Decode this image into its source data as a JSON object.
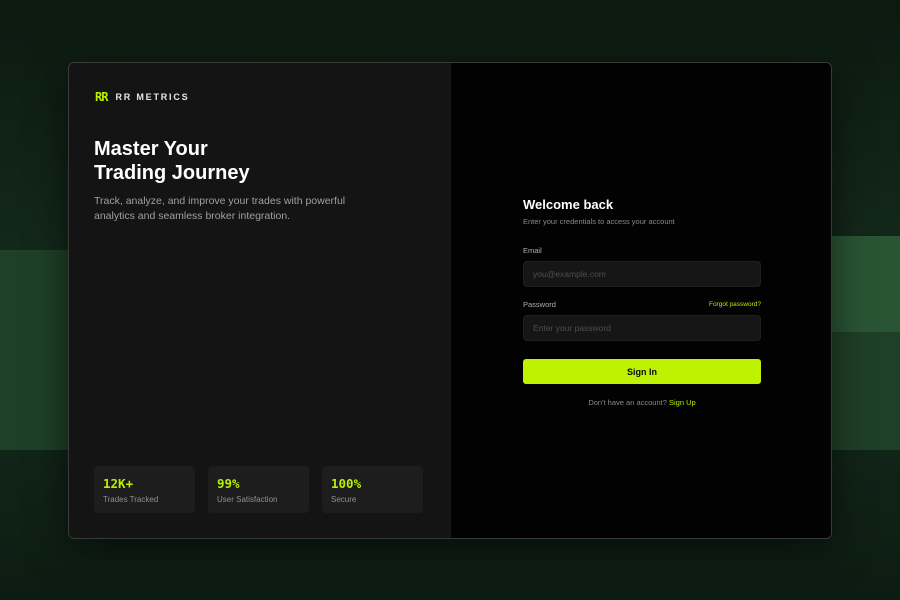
{
  "colors": {
    "accent": "#b8f000",
    "left_panel_bg": "#141414",
    "right_panel_bg": "#020202",
    "page_bg": "#0f1f14"
  },
  "brand": {
    "logo_text": "RR",
    "name": "RR METRICS"
  },
  "hero": {
    "title_line1": "Master Your",
    "title_line2": "Trading Journey",
    "subtitle": "Track, analyze, and improve your trades with powerful analytics and seamless broker integration."
  },
  "stats": [
    {
      "value": "12K+",
      "label": "Trades Tracked"
    },
    {
      "value": "99%",
      "label": "User Satisfaction"
    },
    {
      "value": "100%",
      "label": "Secure"
    }
  ],
  "form": {
    "title": "Welcome back",
    "subtitle": "Enter your credentials to access your account",
    "email_label": "Email",
    "email_placeholder": "you@example.com",
    "email_value": "",
    "password_label": "Password",
    "forgot_password": "Forgot password?",
    "password_placeholder": "Enter your password",
    "password_value": "",
    "signin_label": "Sign In",
    "signup_prompt": "Don't have an account?",
    "signup_link": "Sign Up"
  }
}
